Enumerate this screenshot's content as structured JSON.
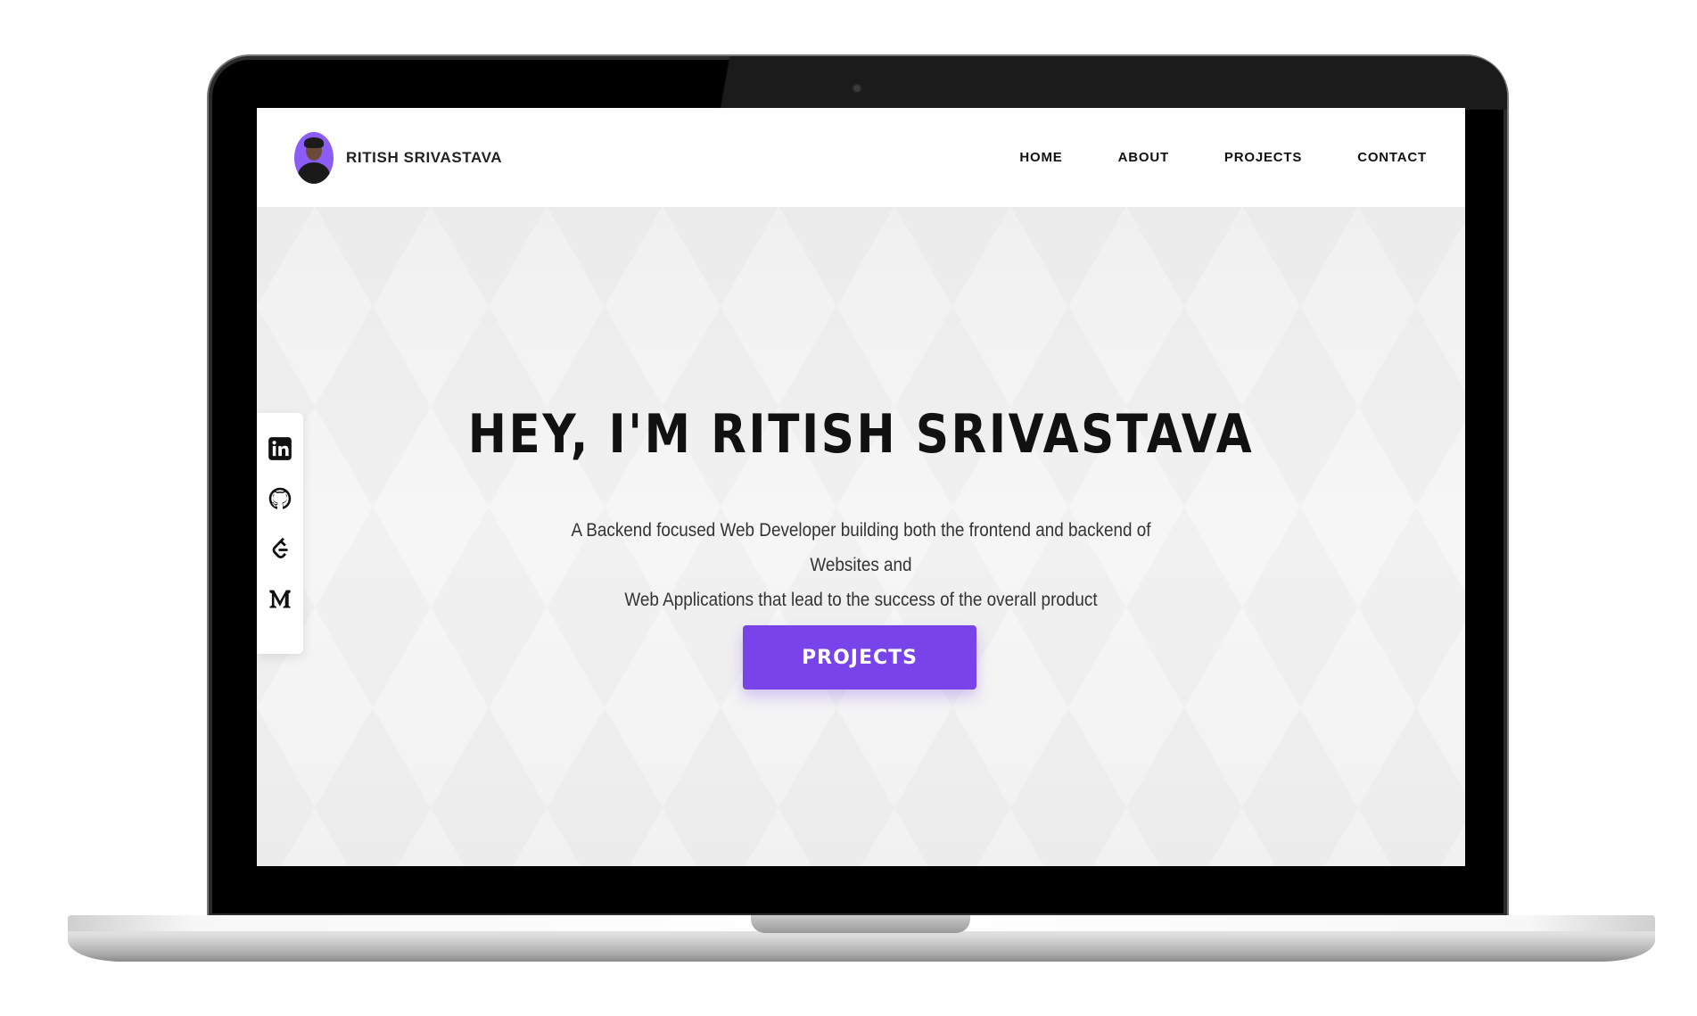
{
  "brand": {
    "name": "RITISH SRIVASTAVA",
    "avatar_color": "#8b5cf6"
  },
  "nav": {
    "items": [
      {
        "label": "HOME"
      },
      {
        "label": "ABOUT"
      },
      {
        "label": "PROJECTS"
      },
      {
        "label": "CONTACT"
      }
    ]
  },
  "hero": {
    "title": "HEY, I'M RITISH SRIVASTAVA",
    "subtitle_line1": "A Backend focused Web Developer building both the frontend and backend of Websites and",
    "subtitle_line2": "Web Applications that lead to the success of the overall product",
    "cta_label": "PROJECTS",
    "accent_color": "#7843e9"
  },
  "social": {
    "icons": [
      "linkedin-icon",
      "github-icon",
      "leetcode-icon",
      "medium-icon"
    ]
  }
}
